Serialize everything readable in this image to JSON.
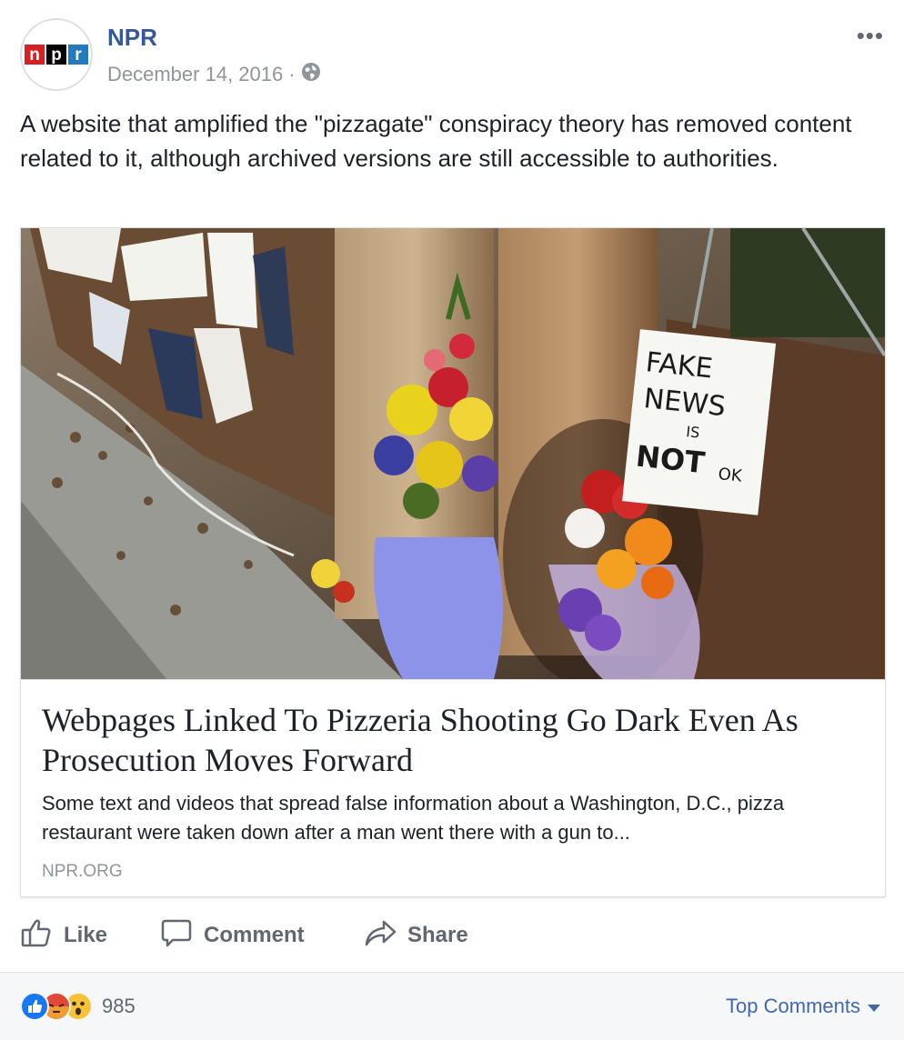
{
  "post": {
    "page_name": "NPR",
    "date": "December 14, 2016",
    "separator": "·",
    "privacy_icon": "globe-icon",
    "more_label": "•••",
    "text": "A website that amplified the \"pizzagate\" conspiracy theory has removed content related to it, although archived versions are still accessible to authorities."
  },
  "logo": {
    "letters": [
      "n",
      "p",
      "r"
    ],
    "colors": [
      "#d62021",
      "#000000",
      "#237bbd"
    ]
  },
  "link_card": {
    "sign_lines": [
      "FAKE",
      "NEWS",
      "IS",
      "NOT",
      "OK"
    ],
    "title": "Webpages Linked To Pizzeria Shooting Go Dark Even As Prosecution Moves Forward",
    "description": "Some text and videos that spread false information about a Washington, D.C., pizza restaurant were taken down after a man went there with a gun to...",
    "domain": "NPR.ORG"
  },
  "actions": {
    "like": "Like",
    "comment": "Comment",
    "share": "Share"
  },
  "footer": {
    "reaction_icons": [
      "like-reaction-icon",
      "angry-reaction-icon",
      "wow-reaction-icon"
    ],
    "reaction_count": "985",
    "sort_label": "Top Comments",
    "accent": "#4267b2"
  }
}
